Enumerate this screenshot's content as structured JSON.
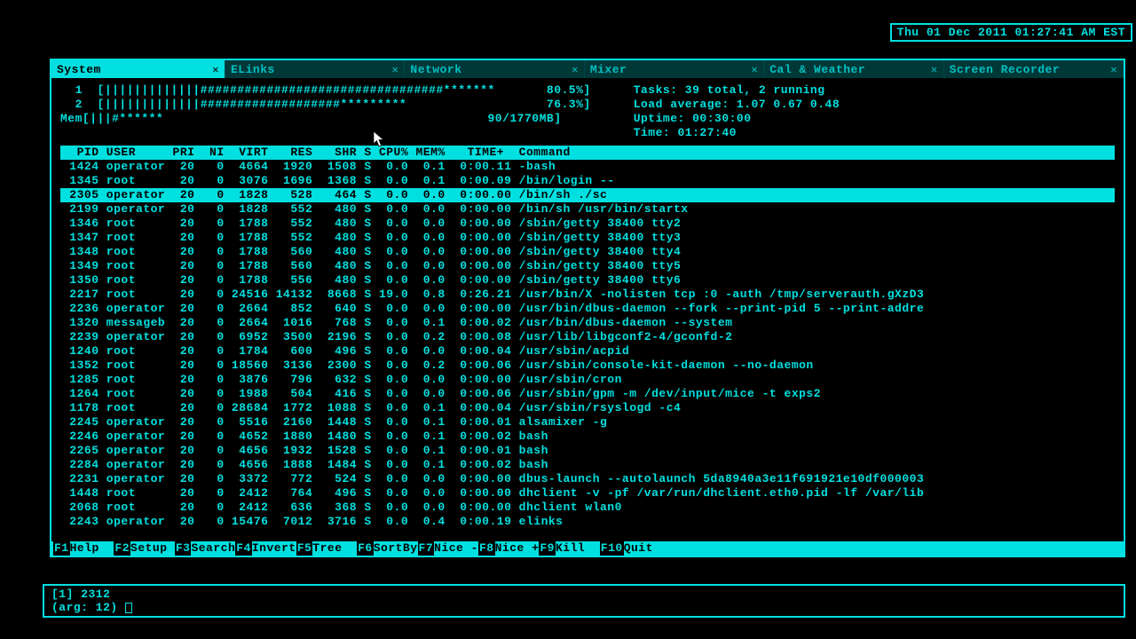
{
  "clock": "Thu 01 Dec 2011 01:27:41 AM EST",
  "tabs": [
    {
      "label": "System",
      "active": true,
      "close": "✕"
    },
    {
      "label": "ELinks",
      "active": false,
      "close": "✕"
    },
    {
      "label": "Network",
      "active": false,
      "close": "✕"
    },
    {
      "label": "Mixer",
      "active": false,
      "close": "✕"
    },
    {
      "label": "Cal & Weather",
      "active": false,
      "close": "✕"
    },
    {
      "label": "Screen Recorder",
      "active": false,
      "close": "✕"
    }
  ],
  "meters": {
    "cpu1_label": "  1  ",
    "cpu1_bar": "[|||||||||||||#################################*******       80.5%]",
    "cpu2_label": "  2  ",
    "cpu2_bar": "[|||||||||||||###################*********                   76.3%]",
    "mem_label": "Mem",
    "mem_bar": "[|||#******                                            90/1770MB]",
    "tasks": "Tasks: 39 total, 2 running",
    "load": "Load average: 1.07 0.67 0.48",
    "uptime": "Uptime: 00:30:00",
    "time": "Time: 01:27:40"
  },
  "columns": "  PID USER     PRI  NI  VIRT   RES   SHR S CPU% MEM%   TIME+  Command",
  "processes": [
    {
      "pid": "1424",
      "user": "operator",
      "pri": "20",
      "ni": "0",
      "virt": "4664",
      "res": "1920",
      "shr": "1508",
      "s": "S",
      "cpu": "0.0",
      "mem": "0.1",
      "time": "0:00.11",
      "cmd": "-bash"
    },
    {
      "pid": "1345",
      "user": "root",
      "pri": "20",
      "ni": "0",
      "virt": "3076",
      "res": "1696",
      "shr": "1368",
      "s": "S",
      "cpu": "0.0",
      "mem": "0.1",
      "time": "0:00.09",
      "cmd": "/bin/login --"
    },
    {
      "pid": "2305",
      "user": "operator",
      "pri": "20",
      "ni": "0",
      "virt": "1828",
      "res": "528",
      "shr": "464",
      "s": "S",
      "cpu": "0.0",
      "mem": "0.0",
      "time": "0:00.00",
      "cmd": "/bin/sh ./sc",
      "selected": true
    },
    {
      "pid": "2199",
      "user": "operator",
      "pri": "20",
      "ni": "0",
      "virt": "1828",
      "res": "552",
      "shr": "480",
      "s": "S",
      "cpu": "0.0",
      "mem": "0.0",
      "time": "0:00.00",
      "cmd": "/bin/sh /usr/bin/startx"
    },
    {
      "pid": "1346",
      "user": "root",
      "pri": "20",
      "ni": "0",
      "virt": "1788",
      "res": "552",
      "shr": "480",
      "s": "S",
      "cpu": "0.0",
      "mem": "0.0",
      "time": "0:00.00",
      "cmd": "/sbin/getty 38400 tty2"
    },
    {
      "pid": "1347",
      "user": "root",
      "pri": "20",
      "ni": "0",
      "virt": "1788",
      "res": "552",
      "shr": "480",
      "s": "S",
      "cpu": "0.0",
      "mem": "0.0",
      "time": "0:00.00",
      "cmd": "/sbin/getty 38400 tty3"
    },
    {
      "pid": "1348",
      "user": "root",
      "pri": "20",
      "ni": "0",
      "virt": "1788",
      "res": "560",
      "shr": "480",
      "s": "S",
      "cpu": "0.0",
      "mem": "0.0",
      "time": "0:00.00",
      "cmd": "/sbin/getty 38400 tty4"
    },
    {
      "pid": "1349",
      "user": "root",
      "pri": "20",
      "ni": "0",
      "virt": "1788",
      "res": "560",
      "shr": "480",
      "s": "S",
      "cpu": "0.0",
      "mem": "0.0",
      "time": "0:00.00",
      "cmd": "/sbin/getty 38400 tty5"
    },
    {
      "pid": "1350",
      "user": "root",
      "pri": "20",
      "ni": "0",
      "virt": "1788",
      "res": "556",
      "shr": "480",
      "s": "S",
      "cpu": "0.0",
      "mem": "0.0",
      "time": "0:00.00",
      "cmd": "/sbin/getty 38400 tty6"
    },
    {
      "pid": "2217",
      "user": "root",
      "pri": "20",
      "ni": "0",
      "virt": "24516",
      "res": "14132",
      "shr": "8668",
      "s": "S",
      "cpu": "19.0",
      "mem": "0.8",
      "time": "0:26.21",
      "cmd": "/usr/bin/X -nolisten tcp :0 -auth /tmp/serverauth.gXzD3"
    },
    {
      "pid": "2236",
      "user": "operator",
      "pri": "20",
      "ni": "0",
      "virt": "2664",
      "res": "852",
      "shr": "640",
      "s": "S",
      "cpu": "0.0",
      "mem": "0.0",
      "time": "0:00.00",
      "cmd": "/usr/bin/dbus-daemon --fork --print-pid 5 --print-addre"
    },
    {
      "pid": "1320",
      "user": "messageb",
      "pri": "20",
      "ni": "0",
      "virt": "2664",
      "res": "1016",
      "shr": "768",
      "s": "S",
      "cpu": "0.0",
      "mem": "0.1",
      "time": "0:00.02",
      "cmd": "/usr/bin/dbus-daemon --system"
    },
    {
      "pid": "2239",
      "user": "operator",
      "pri": "20",
      "ni": "0",
      "virt": "6952",
      "res": "3500",
      "shr": "2196",
      "s": "S",
      "cpu": "0.0",
      "mem": "0.2",
      "time": "0:00.08",
      "cmd": "/usr/lib/libgconf2-4/gconfd-2"
    },
    {
      "pid": "1240",
      "user": "root",
      "pri": "20",
      "ni": "0",
      "virt": "1784",
      "res": "600",
      "shr": "496",
      "s": "S",
      "cpu": "0.0",
      "mem": "0.0",
      "time": "0:00.04",
      "cmd": "/usr/sbin/acpid"
    },
    {
      "pid": "1352",
      "user": "root",
      "pri": "20",
      "ni": "0",
      "virt": "18560",
      "res": "3136",
      "shr": "2300",
      "s": "S",
      "cpu": "0.0",
      "mem": "0.2",
      "time": "0:00.06",
      "cmd": "/usr/sbin/console-kit-daemon --no-daemon"
    },
    {
      "pid": "1285",
      "user": "root",
      "pri": "20",
      "ni": "0",
      "virt": "3876",
      "res": "796",
      "shr": "632",
      "s": "S",
      "cpu": "0.0",
      "mem": "0.0",
      "time": "0:00.00",
      "cmd": "/usr/sbin/cron"
    },
    {
      "pid": "1264",
      "user": "root",
      "pri": "20",
      "ni": "0",
      "virt": "1988",
      "res": "504",
      "shr": "416",
      "s": "S",
      "cpu": "0.0",
      "mem": "0.0",
      "time": "0:00.06",
      "cmd": "/usr/sbin/gpm -m /dev/input/mice -t exps2"
    },
    {
      "pid": "1178",
      "user": "root",
      "pri": "20",
      "ni": "0",
      "virt": "28684",
      "res": "1772",
      "shr": "1088",
      "s": "S",
      "cpu": "0.0",
      "mem": "0.1",
      "time": "0:00.04",
      "cmd": "/usr/sbin/rsyslogd -c4"
    },
    {
      "pid": "2245",
      "user": "operator",
      "pri": "20",
      "ni": "0",
      "virt": "5516",
      "res": "2160",
      "shr": "1448",
      "s": "S",
      "cpu": "0.0",
      "mem": "0.1",
      "time": "0:00.01",
      "cmd": "alsamixer -g"
    },
    {
      "pid": "2246",
      "user": "operator",
      "pri": "20",
      "ni": "0",
      "virt": "4652",
      "res": "1880",
      "shr": "1480",
      "s": "S",
      "cpu": "0.0",
      "mem": "0.1",
      "time": "0:00.02",
      "cmd": "bash"
    },
    {
      "pid": "2265",
      "user": "operator",
      "pri": "20",
      "ni": "0",
      "virt": "4656",
      "res": "1932",
      "shr": "1528",
      "s": "S",
      "cpu": "0.0",
      "mem": "0.1",
      "time": "0:00.01",
      "cmd": "bash"
    },
    {
      "pid": "2284",
      "user": "operator",
      "pri": "20",
      "ni": "0",
      "virt": "4656",
      "res": "1888",
      "shr": "1484",
      "s": "S",
      "cpu": "0.0",
      "mem": "0.1",
      "time": "0:00.02",
      "cmd": "bash"
    },
    {
      "pid": "2231",
      "user": "operator",
      "pri": "20",
      "ni": "0",
      "virt": "3372",
      "res": "772",
      "shr": "524",
      "s": "S",
      "cpu": "0.0",
      "mem": "0.0",
      "time": "0:00.00",
      "cmd": "dbus-launch --autolaunch 5da8940a3e11f691921e10df000003"
    },
    {
      "pid": "1448",
      "user": "root",
      "pri": "20",
      "ni": "0",
      "virt": "2412",
      "res": "764",
      "shr": "496",
      "s": "S",
      "cpu": "0.0",
      "mem": "0.0",
      "time": "0:00.00",
      "cmd": "dhclient -v -pf /var/run/dhclient.eth0.pid -lf /var/lib"
    },
    {
      "pid": "2068",
      "user": "root",
      "pri": "20",
      "ni": "0",
      "virt": "2412",
      "res": "636",
      "shr": "368",
      "s": "S",
      "cpu": "0.0",
      "mem": "0.0",
      "time": "0:00.00",
      "cmd": "dhclient wlan0"
    },
    {
      "pid": "2243",
      "user": "operator",
      "pri": "20",
      "ni": "0",
      "virt": "15476",
      "res": "7012",
      "shr": "3716",
      "s": "S",
      "cpu": "0.0",
      "mem": "0.4",
      "time": "0:00.19",
      "cmd": "elinks"
    }
  ],
  "fkeys": [
    {
      "key": "F1",
      "label": "Help  "
    },
    {
      "key": "F2",
      "label": "Setup "
    },
    {
      "key": "F3",
      "label": "Search"
    },
    {
      "key": "F4",
      "label": "Invert"
    },
    {
      "key": "F5",
      "label": "Tree  "
    },
    {
      "key": "F6",
      "label": "SortBy"
    },
    {
      "key": "F7",
      "label": "Nice -"
    },
    {
      "key": "F8",
      "label": "Nice +"
    },
    {
      "key": "F9",
      "label": "Kill  "
    },
    {
      "key": "F10",
      "label": "Quit  "
    }
  ],
  "bottom": {
    "line1": "[1] 2312",
    "line2_prefix": "(arg: 12) "
  }
}
